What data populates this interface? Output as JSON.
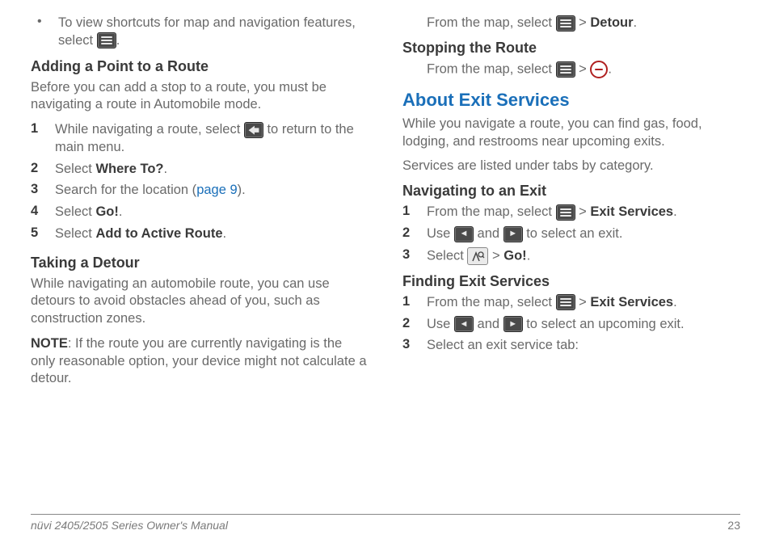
{
  "col1": {
    "bullet1_a": "To view shortcuts for map and navigation features, select ",
    "bullet1_b": ".",
    "h1": "Adding a Point to a Route",
    "p1": "Before you can add a stop to a route, you must be navigating a route in Automobile mode.",
    "s1_num": "1",
    "s1_a": "While navigating a route, select ",
    "s1_b": " to return to the main menu.",
    "s2_num": "2",
    "s2_a": "Select ",
    "s2_b": "Where To?",
    "s2_c": ".",
    "s3_num": "3",
    "s3_a": "Search for the location (",
    "s3_link": "page 9",
    "s3_b": ").",
    "s4_num": "4",
    "s4_a": "Select ",
    "s4_b": "Go!",
    "s4_c": ".",
    "s5_num": "5",
    "s5_a": "Select ",
    "s5_b": "Add to Active Route",
    "s5_c": ".",
    "h2": "Taking a Detour",
    "p2": "While navigating an automobile route, you can use detours to avoid obstacles ahead of you, such as construction zones.",
    "p3_a": "NOTE",
    "p3_b": ": If the route you are currently navigating is the only reasonable option, your device might not calculate a detour."
  },
  "col2": {
    "p0_a": "From the map, select ",
    "p0_b": " > ",
    "p0_c": "Detour",
    "p0_d": ".",
    "h1": "Stopping the Route",
    "p1_a": "From the map, select ",
    "p1_b": " > ",
    "p1_c": ".",
    "h2": "About Exit Services",
    "p2": "While you navigate a route, you can find gas, food, lodging, and restrooms near upcoming exits.",
    "p3": "Services are listed under tabs by category.",
    "h3": "Navigating to an Exit",
    "s1_num": "1",
    "s1_a": "From the map, select ",
    "s1_b": " > ",
    "s1_c": "Exit Services",
    "s1_d": ".",
    "s2_num": "2",
    "s2_a": "Use ",
    "s2_b": " and ",
    "s2_c": " to select an exit.",
    "s3_num": "3",
    "s3_a": "Select ",
    "s3_b": " > ",
    "s3_c": "Go!",
    "s3_d": ".",
    "h4": "Finding Exit Services",
    "t1_num": "1",
    "t1_a": "From the map, select ",
    "t1_b": " > ",
    "t1_c": "Exit Services",
    "t1_d": ".",
    "t2_num": "2",
    "t2_a": "Use ",
    "t2_b": " and ",
    "t2_c": " to select an upcoming exit.",
    "t3_num": "3",
    "t3_a": "Select an exit service tab:"
  },
  "footer": {
    "left": "nüvi 2405/2505 Series Owner's Manual",
    "right": "23"
  }
}
